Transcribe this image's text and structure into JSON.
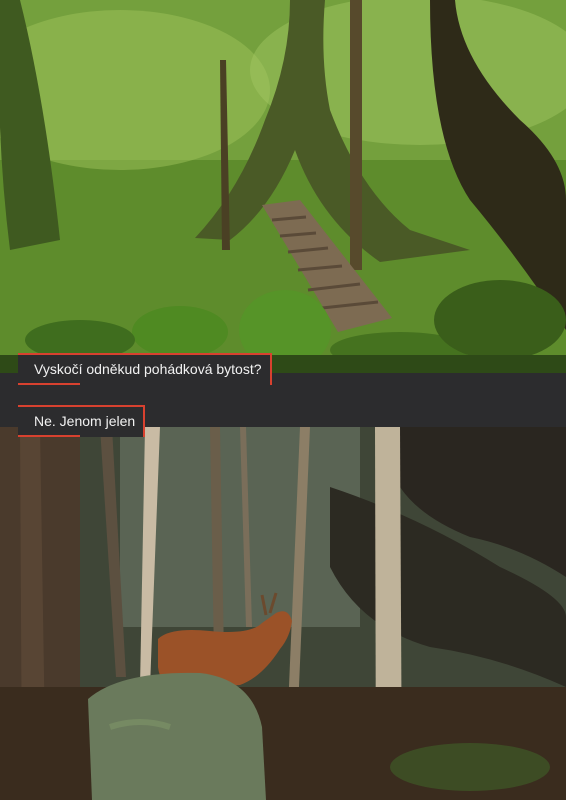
{
  "captions": {
    "question": "Vyskočí odněkud pohádková bytost?",
    "answer": "Ne. Jenom jelen"
  },
  "colors": {
    "accent": "#d8412f",
    "band": "#2c2c2e",
    "text": "#f2f2f2"
  }
}
